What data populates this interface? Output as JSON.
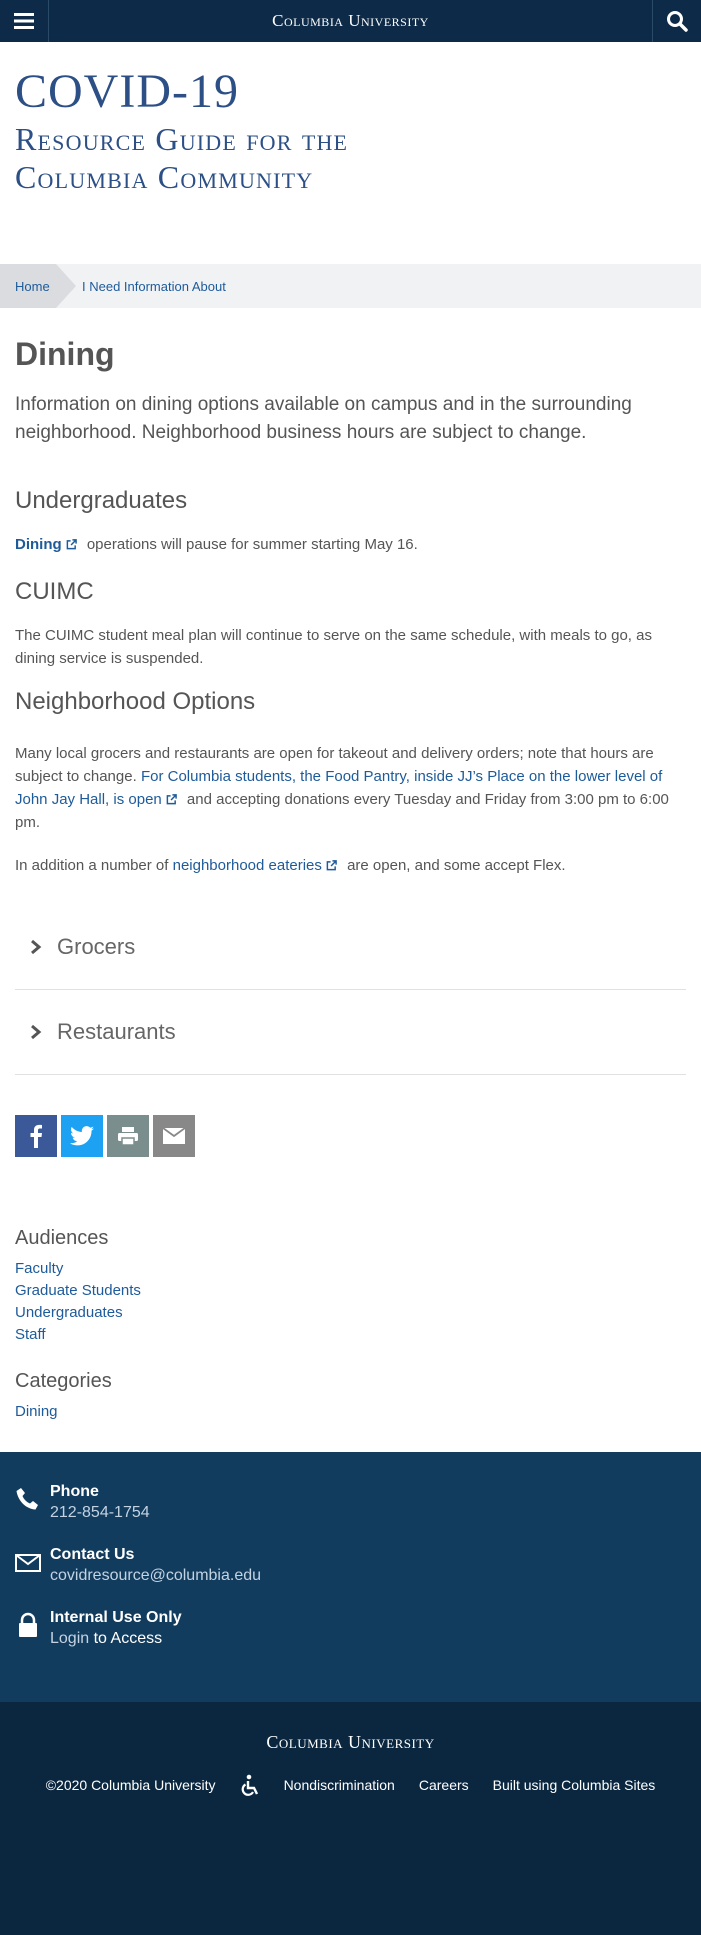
{
  "topbar": {
    "brand": "Columbia University"
  },
  "site": {
    "title_line1": "COVID-19",
    "title_line2": "Resource Guide for the",
    "title_line3": "Columbia Community"
  },
  "breadcrumb": {
    "home": "Home",
    "current": "I Need Information About"
  },
  "page": {
    "title": "Dining",
    "lede": "Information on dining options available on campus and in the surrounding neighborhood. Neighborhood business hours are subject to change."
  },
  "undergrad": {
    "heading": "Undergraduates",
    "link": "Dining",
    "text": "operations will pause for summer starting May 16."
  },
  "cuimc": {
    "heading": "CUIMC",
    "text": "The CUIMC student meal plan will continue to serve on the same schedule, with meals to go, as dining service is suspended."
  },
  "neighborhood": {
    "heading": "Neighborhood Options",
    "text1": "Many local grocers and restaurants are open for takeout and delivery orders; note that hours are subject to change.",
    "link1": "For Columbia students, the Food Pantry, inside JJ’s Place on the lower level of John Jay Hall, is open",
    "text2": "and accepting donations every Tuesday and Friday from 3:00 pm to 6:00 pm.",
    "p2_before": "In addition a number of",
    "p2_link": "neighborhood eateries",
    "p2_after": "are open, and some accept Flex."
  },
  "accordion": {
    "grocers": "Grocers",
    "restaurants": "Restaurants"
  },
  "audiences": {
    "heading": "Audiences",
    "items": [
      "Faculty",
      "Graduate Students",
      "Undergraduates",
      "Staff"
    ]
  },
  "categories": {
    "heading": "Categories",
    "items": [
      "Dining"
    ]
  },
  "footer": {
    "phone_title": "Phone",
    "phone": "212-854-1754",
    "contact_title": "Contact Us",
    "email": "covidresource@columbia.edu",
    "internal_title": "Internal Use Only",
    "login": "Login",
    "login_after": "to Access",
    "brand": "Columbia University",
    "copyright": "©2020 Columbia University",
    "nondiscrimination": "Nondiscrimination",
    "careers": "Careers",
    "built": "Built using Columbia Sites"
  },
  "colors": {
    "navy": "#0d2b48",
    "link": "#1e5b9a",
    "title": "#2c4f86",
    "facebook": "#3b5998",
    "twitter": "#1da1f2",
    "print": "#7b8e8e",
    "email": "#888888"
  }
}
